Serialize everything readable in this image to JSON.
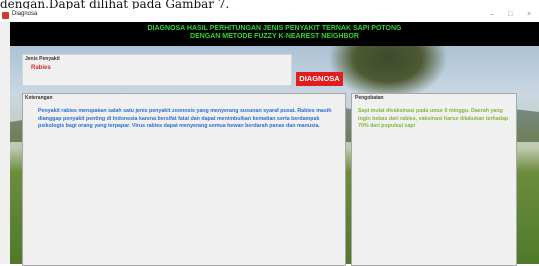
{
  "document_caption": "dengan.Dapat dilihat pada Gambar 7.",
  "window": {
    "title": "Diagnosa",
    "controls": {
      "minimize": "–",
      "maximize": "□",
      "close": "×"
    }
  },
  "header": {
    "line1": "DIAGNOSA HASIL PERHITUNGAN JENIS PENYAKIT TERNAK SAPI POTONG",
    "line2": "DENGAN METODE FUZZY K-NEAREST NEIGHBOR",
    "color": "#2ed62e"
  },
  "jenis_penyakit": {
    "label": "Jenis Penyakit",
    "value": "Rabies",
    "value_color": "#cc2b2b"
  },
  "diagnosa_button": {
    "label": "DIAGNOSA",
    "color": "#e31d1d"
  },
  "keterangan": {
    "label": "Keterangan",
    "text": "Penyakit rabies merupakan salah satu jenis penyakit zoonosis yang menyerang susunan syaraf pusat. Rabies masih dianggap penyakit penting di Indonesia karena bersifat fatal dan dapat menimbulkan kematian serta berdampak psikologis bagi orang yang terpapar. Virus rabies dapat menyerang semua hewan berdarah panas dan manusia.",
    "text_color": "#2c6fcf"
  },
  "pengobatan": {
    "label": "Pengobatan",
    "text": "Sapi mulai divaksinasi pada umur 6 minggu. Daerah yang ingin bebas dari rabies, vaksinasi harus dilakukan terhadap 70% dari populasi sapi",
    "text_color": "#84b63a"
  }
}
